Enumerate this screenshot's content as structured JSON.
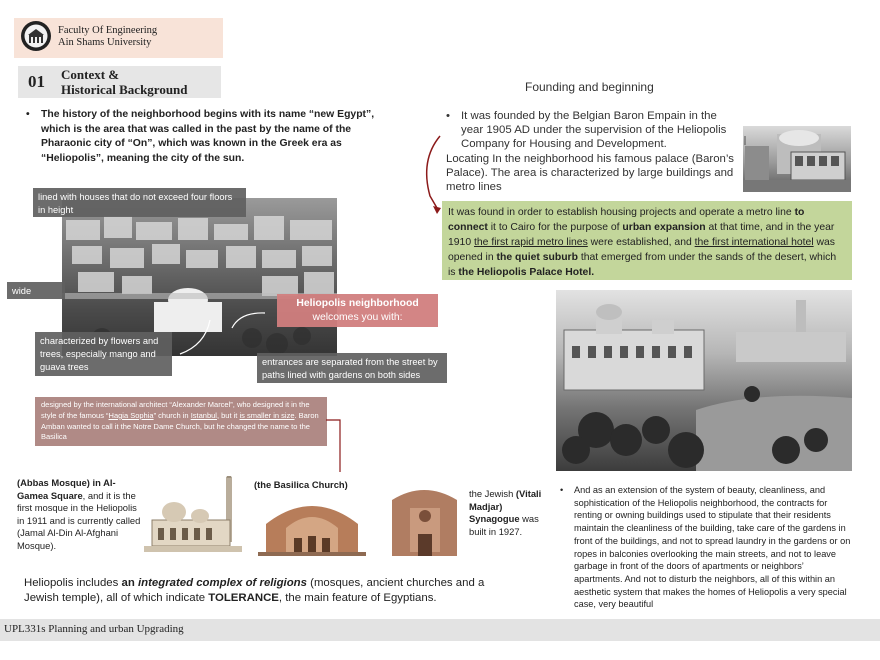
{
  "header": {
    "faculty_line1": "Faculty Of Engineering",
    "faculty_line2": "Ain Shams University",
    "logo_icon": "university-seal-icon"
  },
  "section": {
    "number": "01",
    "title_line1": "Context &",
    "title_line2": "Historical Background"
  },
  "intro": {
    "bullet": "•",
    "text": "The history of the neighborhood begins with its name “new Egypt”, which is the area that was called in the past by the name of the Pharaonic city of “On”, which was known in the Greek era as “Heliopolis”, meaning the city of the sun."
  },
  "labels": {
    "houses": "lined with houses that do not exceed four floors in height",
    "wide_streets": "wide streets",
    "flowers": "characterized by flowers and trees, especially mango and guava trees",
    "entrances": "entrances are separated from the street by paths lined with gardens on both sides",
    "helio_title": "Heliopolis neighborhood",
    "helio_sub": "welcomes you with:"
  },
  "basilica_note": {
    "part1": "designed by the international architect “Alexander Marcel”, who designed it in the style of the famous “",
    "hagia": "Hagia Sophia",
    "part2": "” church in ",
    "istanbul": "Istanbul",
    "part3": ", but it ",
    "smaller": "is smaller in size",
    "part4": ". Baron Amban wanted to call it the Notre Dame Church, but he changed the name to the Basilica"
  },
  "founding": {
    "title": "Founding and beginning",
    "bullet": "•",
    "text_line1": "It was founded by the Belgian Baron Empain in the year 1905 AD under the supervision of the Heliopolis Company for Housing and Development.",
    "text_line2": "Locating In the neighborhood his famous palace (Baron’s Palace). The area is characterized by large buildings and metro lines"
  },
  "green_box": {
    "s1": "It was found in order to establish housing projects and operate a metro line ",
    "b1": "to connect",
    "s2": " it to Cairo for the purpose of ",
    "b2": "urban expansion",
    "s3": " at that time, and in the year 1910 ",
    "u1": "the first rapid metro lines",
    "s4": " were established, and ",
    "u2": "the first international hotel",
    "s5": " was opened in ",
    "b3": "the quiet suburb",
    "s6": " that emerged from under the sands of the desert, which is ",
    "b4": "the Heliopolis Palace Hotel."
  },
  "extension": {
    "bullet": "•",
    "text": "And as an extension of the system of beauty, cleanliness, and sophistication of the Heliopolis neighborhood, the contracts for renting or owning buildings used to stipulate that their residents maintain the cleanliness of the building, take care of the gardens in front of the buildings, and not to spread laundry in the gardens or on ropes in balconies overlooking the main streets, and not to leave garbage in front of the doors of apartments or neighbors’ apartments. And not to disturb the neighbors, all of this within an aesthetic system that makes the homes of Heliopolis a very special case, very beautiful"
  },
  "religions": {
    "abbas_bold": "(Abbas Mosque) in Al-Gamea Square",
    "abbas_rest": ", and it is the first mosque in the Heliopolis in 1911 and is currently called (Jamal Al-Din Al-Afghani Mosque).",
    "basilica": "(the Basilica Church)",
    "jew_pre": "the Jewish ",
    "jew_bold": "(Vitali Madjar) Synagogue",
    "jew_rest": " was built in 1927."
  },
  "summary": {
    "s1": "Heliopolis includes ",
    "b1": "an ",
    "bi1": "integrated complex of religions",
    "s2": " (mosques, ancient churches and a Jewish temple), all of which indicate ",
    "b2": "TOLERANCE",
    "s3": ", the main feature of Egyptians."
  },
  "footer": {
    "course": "UPL331s Planning and urban Upgrading"
  },
  "colors": {
    "header_band": "#f8e3d8",
    "green_box": "#c3d69b",
    "helio_label": "#d17e7e",
    "note_box": "#b08a86",
    "arrow_red": "#8b1a1a"
  }
}
